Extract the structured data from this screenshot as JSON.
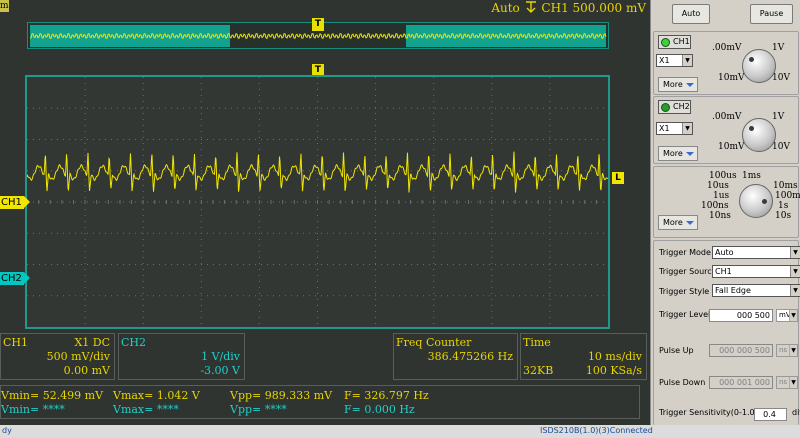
{
  "topbar": {
    "left_tag": "m",
    "trigger_mode": "Auto",
    "trigger_info": "CH1 500.000 mV"
  },
  "markers": {
    "trigger_pos": "T",
    "ch1": "CH1",
    "ch2": "CH2",
    "level": "L"
  },
  "info": {
    "ch1": {
      "title": "CH1",
      "coupling": "X1  DC",
      "scale": "500 mV/div",
      "offset": "0.00 mV"
    },
    "ch2": {
      "title": "CH2",
      "scale": "1 V/div",
      "offset": "-3.00 V"
    },
    "freq": {
      "title": "Freq Counter",
      "value": "386.475266 Hz"
    },
    "time": {
      "title": "Time",
      "scale": "10 ms/div",
      "memory": "32KB",
      "rate": "100 KSa/s"
    }
  },
  "measurements": {
    "ch1": {
      "vmin": "Vmin= 52.499 mV",
      "vmax": "Vmax= 1.042 V",
      "vpp": "Vpp= 989.333 mV",
      "freq": "F= 326.797 Hz"
    },
    "ch2": {
      "vmin": "Vmin= ****",
      "vmax": "Vmax= ****",
      "vpp": "Vpp= ****",
      "freq": "F= 0.000 Hz"
    }
  },
  "statusbar": {
    "left": "dy",
    "right": "ISDS210B(1.0)(3)Connected"
  },
  "panel": {
    "auto_label": "Auto",
    "pause_label": "Pause",
    "ch1": {
      "label": "CH1",
      "probe": "X1",
      "more": "More",
      "k_tl": ".00mV",
      "k_tr": "1V",
      "k_bl": "10mV",
      "k_br": "10V"
    },
    "ch2": {
      "label": "CH2",
      "probe": "X1",
      "more": "More",
      "k_tl": ".00mV",
      "k_tr": "1V",
      "k_bl": "10mV",
      "k_br": "10V"
    },
    "timebase": {
      "more": "More",
      "labels": [
        "100us",
        "1ms",
        "10us",
        "10ms",
        "1us",
        "100m",
        "100ns",
        "1s",
        "10ns",
        "10s"
      ]
    },
    "trigger": {
      "mode_label": "Trigger Mode",
      "mode_value": "Auto",
      "source_label": "Trigger Source",
      "source_value": "CH1",
      "style_label": "Trigger Style",
      "style_value": "Fall Edge",
      "level_label": "Trigger Level",
      "level_value": "000 500",
      "level_unit": "mV",
      "pulse_up_label": "Pulse Up",
      "pulse_up_value": "000 000 500",
      "pulse_up_unit": "ns",
      "pulse_down_label": "Pulse Down",
      "pulse_down_value": "000 001 000",
      "pulse_down_unit": "ns",
      "sens_label": "Trigger Sensitivity(0-1.0)",
      "sens_value": "0.4",
      "sens_unit": "div"
    }
  },
  "colors": {
    "ch1": "#f0e600",
    "ch2": "#00c8c0",
    "grid": "#6a706c",
    "frame": "#1f9a8a"
  }
}
